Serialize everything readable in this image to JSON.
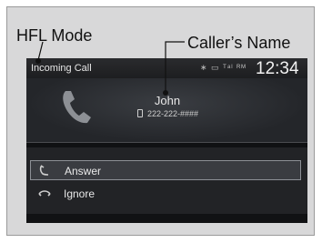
{
  "callouts": {
    "hfl_mode": "HFL Mode",
    "caller_name": "Caller’s Name"
  },
  "status_bar": {
    "title": "Incoming Call",
    "icons_text": "∗ ▭ ᵀᵃˡ ᴿᴹ",
    "clock": "12:34"
  },
  "caller": {
    "name": "John",
    "number": "222-222-####"
  },
  "options": [
    {
      "label": "Answer",
      "icon": "answer-phone-icon"
    },
    {
      "label": "Ignore",
      "icon": "ignore-phone-icon"
    }
  ],
  "colors": {
    "screen_bg": "#1a1b1d",
    "frame_bg": "#d8d8d9",
    "text_light": "#e8e8e8"
  }
}
